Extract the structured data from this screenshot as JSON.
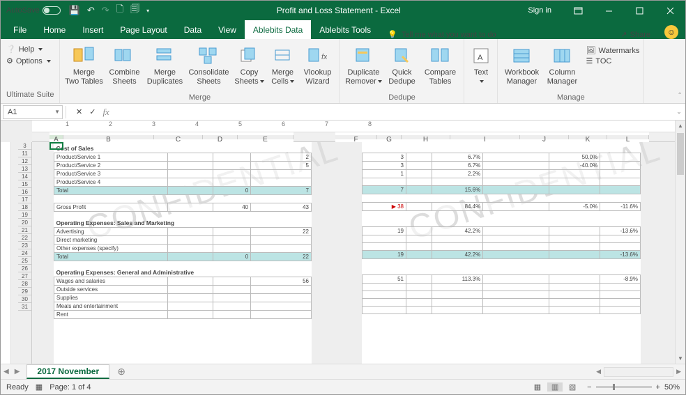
{
  "titlebar": {
    "autosave": "AutoSave",
    "title": "Profit and Loss Statement  -  Excel",
    "signin": "Sign in"
  },
  "tabs": {
    "file": "File",
    "home": "Home",
    "insert": "Insert",
    "pagelayout": "Page Layout",
    "data": "Data",
    "view": "View",
    "ablebits_data": "Ablebits Data",
    "ablebits_tools": "Ablebits Tools",
    "tellme": "Tell me what you want to do",
    "share": "Share"
  },
  "ribbon": {
    "help": "Help",
    "options": "Options",
    "suite": "Ultimate Suite",
    "merge_tables": "Merge\nTwo Tables",
    "combine": "Combine\nSheets",
    "merge_dup": "Merge\nDuplicates",
    "consolidate": "Consolidate\nSheets",
    "copy": "Copy\nSheets",
    "merge_cells": "Merge\nCells",
    "vlookup": "Vlookup\nWizard",
    "grp_merge": "Merge",
    "dup_rem": "Duplicate\nRemover",
    "quick_dedupe": "Quick\nDedupe",
    "compare": "Compare\nTables",
    "grp_dedupe": "Dedupe",
    "text": "Text",
    "wb_mgr": "Workbook\nManager",
    "col_mgr": "Column\nManager",
    "watermarks": "Watermarks",
    "toc": "TOC",
    "grp_manage": "Manage"
  },
  "fbar": {
    "cell": "A1"
  },
  "ruler": {
    "t1": "1",
    "t2": "2",
    "t3": "3",
    "t4": "4",
    "t5": "5",
    "t6": "6",
    "t7": "7",
    "t8": "8"
  },
  "rows": [
    "3",
    "11",
    "12",
    "13",
    "14",
    "15",
    "16",
    "17",
    "18",
    "19",
    "20",
    "21",
    "22",
    "23",
    "24",
    "25",
    "26",
    "27",
    "28",
    "29",
    "30",
    "31"
  ],
  "columns_left": [
    "A",
    "B",
    "C",
    "D",
    "E"
  ],
  "columns_right": [
    "F",
    "G",
    "H",
    "I",
    "J",
    "K",
    "L"
  ],
  "watermark": "CONFIDENTIAL",
  "report": {
    "cost_header": "Cost of Sales",
    "rows1": [
      {
        "b": "Product/Service 1",
        "d": "",
        "e": "2",
        "f": "3",
        "h": "6.7%",
        "j": "50.0%",
        "k": ""
      },
      {
        "b": "Product/Service 2",
        "d": "",
        "e": "5",
        "f": "3",
        "h": "6.7%",
        "j": "-40.0%",
        "k": ""
      },
      {
        "b": "Product/Service 3",
        "d": "",
        "e": "",
        "f": "1",
        "h": "2.2%",
        "j": "",
        "k": ""
      },
      {
        "b": "Product/Service 4",
        "d": "",
        "e": "",
        "f": "",
        "h": "",
        "j": "",
        "k": ""
      }
    ],
    "total1": {
      "b": "Total",
      "d": "0",
      "e": "7",
      "f": "7",
      "h": "15.6%",
      "j": "",
      "k": ""
    },
    "gross": {
      "b": "Gross Profit",
      "d": "40",
      "e": "43",
      "f": "38",
      "h": "84.4%",
      "j": "-5.0%",
      "k": "-11.6%"
    },
    "opex_sm": "Operating Expenses: Sales and Marketing",
    "rows2": [
      {
        "b": "Advertising",
        "d": "",
        "e": "22",
        "f": "19",
        "h": "42.2%",
        "j": "",
        "k": "-13.6%"
      },
      {
        "b": "Direct marketing",
        "d": "",
        "e": "",
        "f": "",
        "h": "",
        "j": "",
        "k": ""
      },
      {
        "b": "Other expenses (specify)",
        "d": "",
        "e": "",
        "f": "",
        "h": "",
        "j": "",
        "k": ""
      }
    ],
    "total2": {
      "b": "Total",
      "d": "0",
      "e": "22",
      "f": "19",
      "h": "42.2%",
      "j": "",
      "k": "-13.6%"
    },
    "opex_ga": "Operating Expenses: General and Administrative",
    "rows3": [
      {
        "b": "Wages and salaries",
        "d": "",
        "e": "56",
        "f": "51",
        "h": "113.3%",
        "j": "",
        "k": "-8.9%"
      },
      {
        "b": "Outside services",
        "d": "",
        "e": "",
        "f": "",
        "h": "",
        "j": "",
        "k": ""
      },
      {
        "b": "Supplies",
        "d": "",
        "e": "",
        "f": "",
        "h": "",
        "j": "",
        "k": ""
      },
      {
        "b": "Meals and entertainment",
        "d": "",
        "e": "",
        "f": "",
        "h": "",
        "j": "",
        "k": ""
      },
      {
        "b": "Rent",
        "d": "",
        "e": "",
        "f": "",
        "h": "",
        "j": "",
        "k": ""
      }
    ]
  },
  "sheettab": "2017 November",
  "status": {
    "ready": "Ready",
    "page": "Page: 1 of 4",
    "zoom": "50%"
  }
}
